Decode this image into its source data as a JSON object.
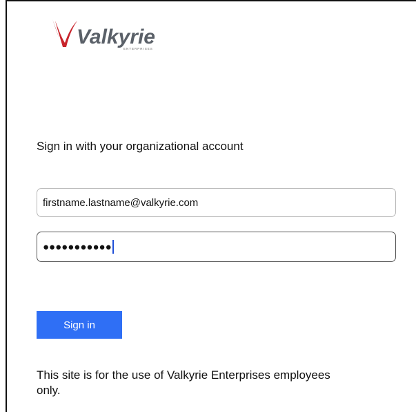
{
  "brand": {
    "name": "Valkyrie",
    "subtitle": "ENTERPRISES"
  },
  "login": {
    "heading": "Sign in with your organizational account",
    "email_value": "firstname.lastname@valkyrie.com",
    "password_mask": "●●●●●●●●●●●",
    "submit_label": "Sign in",
    "notice": "This site is for the use of Valkyrie Enterprises employees only."
  },
  "colors": {
    "button": "#2f6ff5",
    "logo_red": "#c8242c",
    "logo_gray": "#5a6068"
  }
}
